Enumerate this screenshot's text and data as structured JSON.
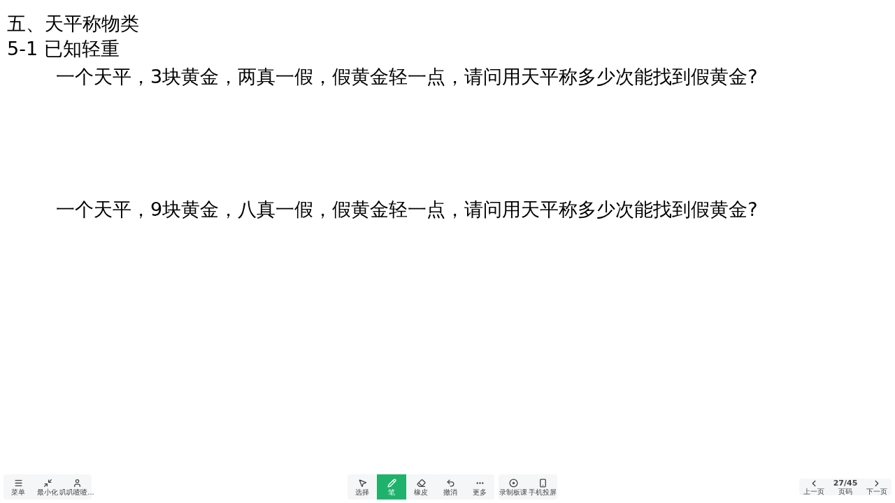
{
  "slide": {
    "heading": "五、天平称物类",
    "subheading": "5-1 已知轻重",
    "questions": [
      "一个天平，3块黄金，两真一假，假黄金轻一点，请问用天平称多少次能找到假黄金?",
      "一个天平，9块黄金，八真一假，假黄金轻一点，请问用天平称多少次能找到假黄金?"
    ]
  },
  "left_toolbar": [
    {
      "kind": "menu",
      "label": "菜单"
    },
    {
      "kind": "minimize",
      "label": "最小化"
    },
    {
      "kind": "avatar",
      "label": "叽叽喳喳..."
    }
  ],
  "tools": [
    {
      "kind": "select",
      "label": "选择",
      "selected": false
    },
    {
      "kind": "pen",
      "label": "笔",
      "selected": true
    },
    {
      "kind": "eraser",
      "label": "橡皮",
      "selected": false
    },
    {
      "kind": "undo",
      "label": "撤消",
      "selected": false
    },
    {
      "kind": "more",
      "label": "更多",
      "selected": false
    }
  ],
  "extra_tools": [
    {
      "kind": "record",
      "label": "录制板课"
    },
    {
      "kind": "phone",
      "label": "手机投屏"
    }
  ],
  "pager": {
    "prev": "上一页",
    "page": "27/45",
    "page_label": "页码",
    "next": "下一页"
  }
}
